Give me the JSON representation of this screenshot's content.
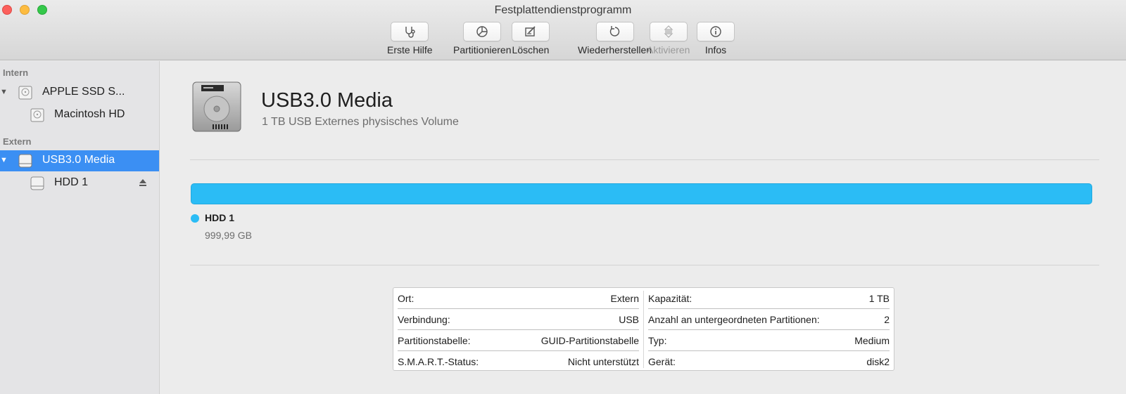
{
  "window": {
    "title": "Festplattendienstprogramm"
  },
  "toolbar": {
    "items": [
      {
        "label": "Erste Hilfe",
        "icon": "stethoscope-icon",
        "enabled": true
      },
      {
        "label": "Partitionieren",
        "icon": "pie-chart-icon",
        "enabled": true
      },
      {
        "label": "Löschen",
        "icon": "erase-icon",
        "enabled": true
      },
      {
        "label": "Wiederherstellen",
        "icon": "restore-icon",
        "enabled": true
      },
      {
        "label": "Aktivieren",
        "icon": "mount-icon",
        "enabled": false
      },
      {
        "label": "Infos",
        "icon": "info-icon",
        "enabled": true
      }
    ]
  },
  "sidebar": {
    "sections": [
      {
        "header": "Intern",
        "items": [
          {
            "label": "APPLE SSD S...",
            "icon": "internal-disk-icon",
            "expanded": true,
            "selected": false
          },
          {
            "label": "Macintosh HD",
            "icon": "volume-icon",
            "selected": false
          }
        ]
      },
      {
        "header": "Extern",
        "items": [
          {
            "label": "USB3.0 Media",
            "icon": "external-disk-icon",
            "expanded": true,
            "selected": true
          },
          {
            "label": "HDD 1",
            "icon": "external-volume-icon",
            "selected": false,
            "eject_icon": "eject-icon"
          }
        ]
      }
    ]
  },
  "main": {
    "disk_name": "USB3.0 Media",
    "disk_subtitle": "1 TB USB Externes physisches Volume",
    "usage": {
      "accent": "#2bbcf5",
      "partitions": [
        {
          "name": "HDD 1",
          "size": "999,99 GB",
          "fraction": 1.0
        }
      ]
    },
    "info": {
      "left": [
        {
          "label": "Ort:",
          "value": "Extern"
        },
        {
          "label": "Verbindung:",
          "value": "USB"
        },
        {
          "label": "Partitionstabelle:",
          "value": "GUID-Partitionstabelle"
        },
        {
          "label": "S.M.A.R.T.-Status:",
          "value": "Nicht unterstützt"
        }
      ],
      "right": [
        {
          "label": "Kapazität:",
          "value": "1 TB"
        },
        {
          "label": "Anzahl an untergeordneten Partitionen:",
          "value": "2"
        },
        {
          "label": "Typ:",
          "value": "Medium"
        },
        {
          "label": "Gerät:",
          "value": "disk2"
        }
      ]
    }
  },
  "colors": {
    "selection": "#3b8ff3",
    "accent": "#2bbcf5"
  }
}
